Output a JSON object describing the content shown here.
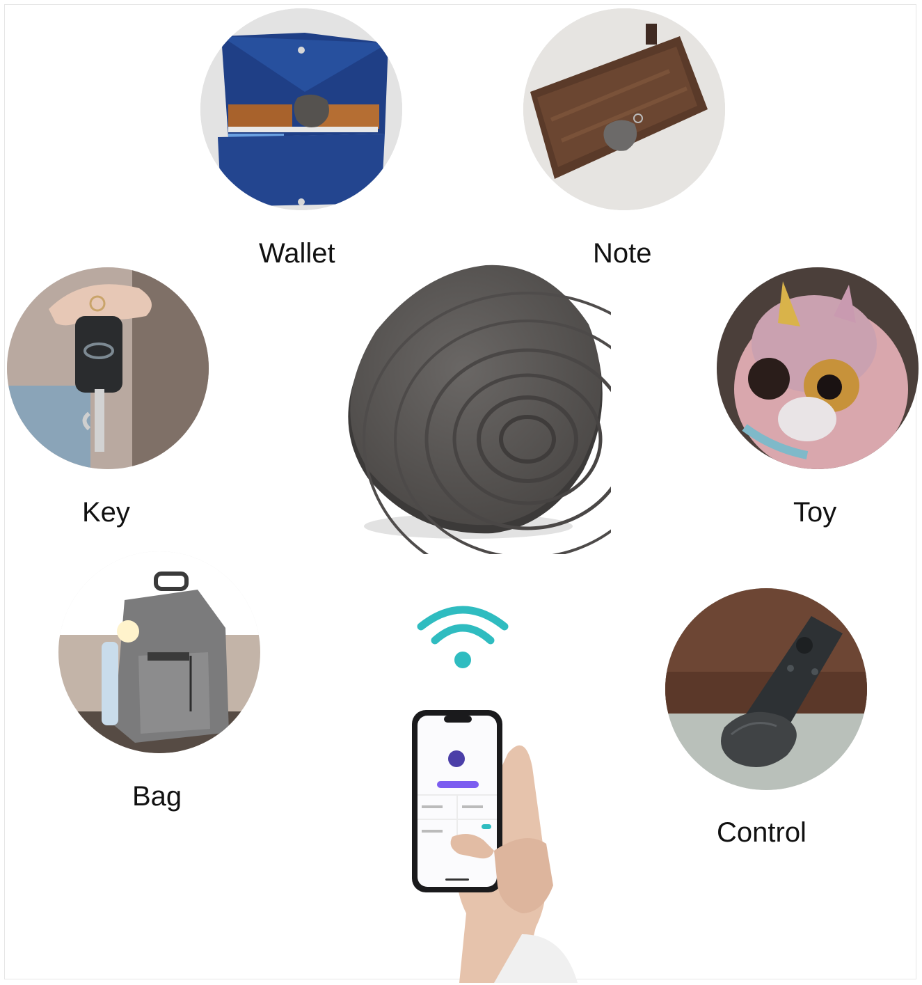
{
  "items": [
    {
      "label": "Wallet"
    },
    {
      "label": "Note"
    },
    {
      "label": "Key"
    },
    {
      "label": "Toy"
    },
    {
      "label": "Bag"
    },
    {
      "label": "Control"
    }
  ],
  "colors": {
    "tracker": "#595654",
    "wifi": "#2fbcc0",
    "app_accent": "#7b5cf0"
  }
}
